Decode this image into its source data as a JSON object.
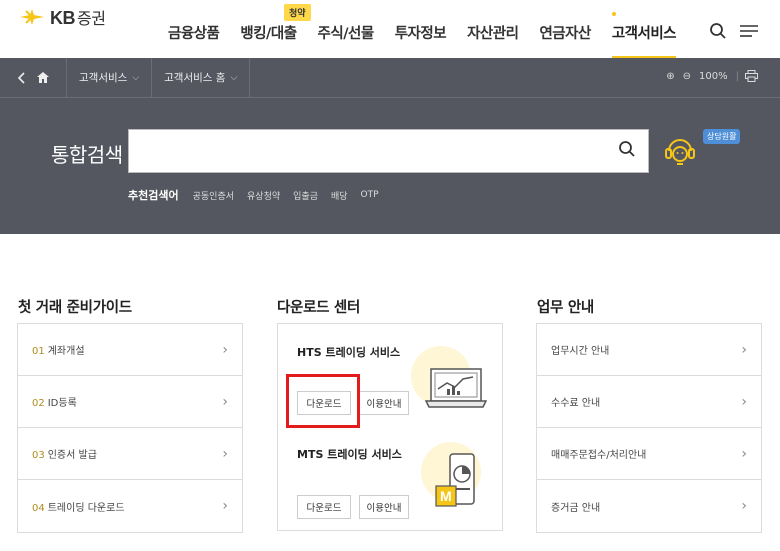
{
  "logo": {
    "brand": "KB",
    "name": "증권"
  },
  "nav": {
    "items": [
      "금융상품",
      "뱅킹/대출",
      "주식/선물",
      "투자정보",
      "자산관리",
      "연금자산",
      "고객서비스"
    ],
    "active": "고객서비스",
    "new_badge": "청약"
  },
  "breadcrumb": {
    "level1": "고객서비스",
    "level2": "고객서비스 홈"
  },
  "zoom": {
    "value": "100%"
  },
  "search": {
    "label": "통합검색",
    "value": "",
    "help_badge": "상담원활",
    "recommend_title": "추천검색어",
    "tags": [
      "공동인증서",
      "유상청약",
      "입출금",
      "배당",
      "OTP"
    ]
  },
  "guide": {
    "title": "첫 거래 준비가이드",
    "items": [
      {
        "num": "01",
        "label": "계좌개설"
      },
      {
        "num": "02",
        "label": "ID등록"
      },
      {
        "num": "03",
        "label": "인증서 발급"
      },
      {
        "num": "04",
        "label": "트레이딩 다운로드"
      }
    ]
  },
  "download": {
    "title": "다운로드 센터",
    "hts": {
      "title": "HTS 트레이딩 서비스",
      "download": "다운로드",
      "guide": "이용안내"
    },
    "mts": {
      "title": "MTS 트레이딩 서비스",
      "download": "다운로드",
      "guide": "이용안내"
    }
  },
  "business": {
    "title": "업무 안내",
    "items": [
      "업무시간 안내",
      "수수료 안내",
      "매매주문접수/처리안내",
      "증거금 안내"
    ]
  },
  "colors": {
    "accent": "#f5c518",
    "band": "#545760",
    "highlight": "#e31b1b"
  }
}
